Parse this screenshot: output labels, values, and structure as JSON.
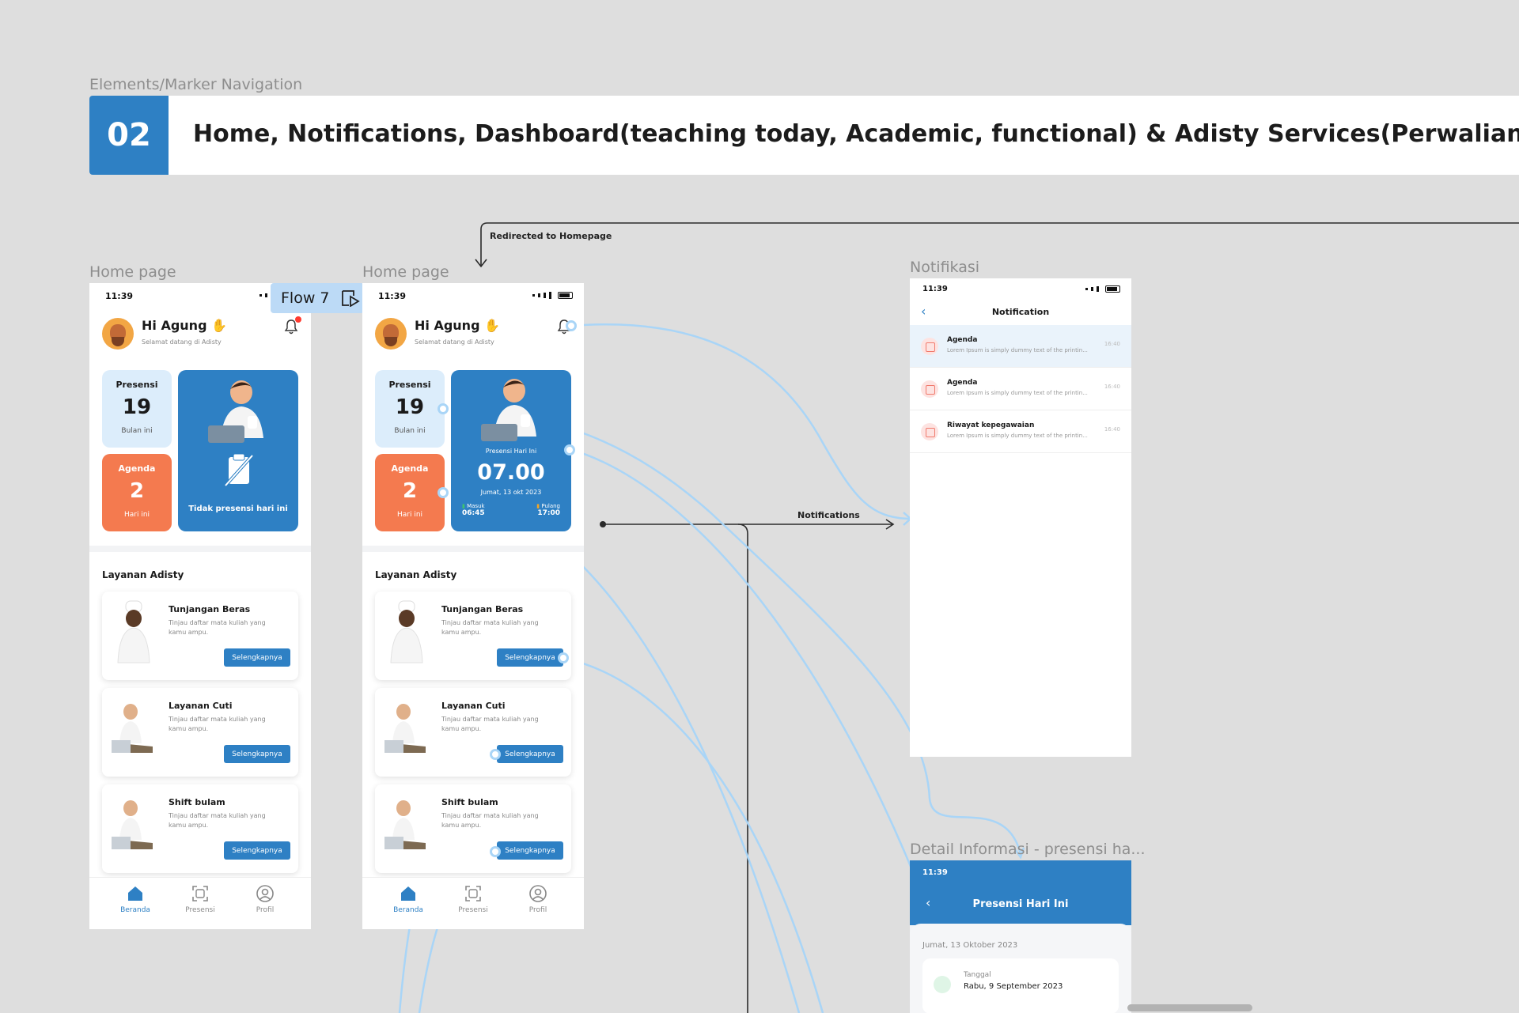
{
  "section_label": "Elements/Marker Navigation",
  "banner": {
    "number": "02",
    "title": "Home, Notifications, Dashboard(teaching today, Academic, functional)  & Adisty Services(Perwalian, Tugas Akhir, Agen"
  },
  "flow_tag": "Flow 7",
  "connector_labels": {
    "redirect": "Redirected to Homepage",
    "notifications": "Notifications"
  },
  "frames": {
    "home1": "Home page",
    "home2": "Home page",
    "notif": "Notifikasi",
    "detail": "Detail Informasi - presensi ha..."
  },
  "home": {
    "time": "11:39",
    "greeting": "Hi Agung",
    "welcome": "Selamat datang di Adisty",
    "presensi": {
      "label": "Presensi",
      "value": "19",
      "unit": "Bulan ini"
    },
    "agenda": {
      "label": "Agenda",
      "value": "2",
      "unit": "Hari ini"
    },
    "no_presence": "Tidak presensi hari ini",
    "today": {
      "label": "Presensi Hari Ini",
      "time": "07.00",
      "date": "Jumat, 13 okt 2023",
      "in_label": "Masuk",
      "in_time": "06:45",
      "out_label": "Pulang",
      "out_time": "17:00"
    },
    "services_title": "Layanan Adisty",
    "services": [
      {
        "name": "Tunjangan Beras",
        "desc": "Tinjau daftar mata kuliah yang kamu ampu.",
        "button": "Selengkapnya"
      },
      {
        "name": "Layanan Cuti",
        "desc": "Tinjau daftar mata kuliah yang kamu ampu.",
        "button": "Selengkapnya"
      },
      {
        "name": "Shift bulam",
        "desc": "Tinjau daftar mata kuliah yang kamu ampu.",
        "button": "Selengkapnya"
      }
    ],
    "tabs": [
      "Beranda",
      "Presensi",
      "Profil"
    ]
  },
  "notification": {
    "time": "11:39",
    "title": "Notification",
    "items": [
      {
        "title": "Agenda",
        "desc": "Lorem Ipsum is simply dummy text of the printin...",
        "time": "16:40"
      },
      {
        "title": "Agenda",
        "desc": "Lorem Ipsum is simply dummy text of the printin...",
        "time": "16:40"
      },
      {
        "title": "Riwayat kepegawaian",
        "desc": "Lorem Ipsum is simply dummy text of the printin...",
        "time": "16:40"
      }
    ]
  },
  "detail": {
    "time": "11:39",
    "title": "Presensi Hari Ini",
    "date": "Jumat, 13 Oktober 2023",
    "field_label": "Tanggal",
    "field_value": "Rabu, 9 September 2023"
  },
  "colors": {
    "primary": "#2e80c4",
    "agenda": "#f47a4f",
    "light_card": "#dcedfb",
    "connector": "#a9d5f7"
  }
}
